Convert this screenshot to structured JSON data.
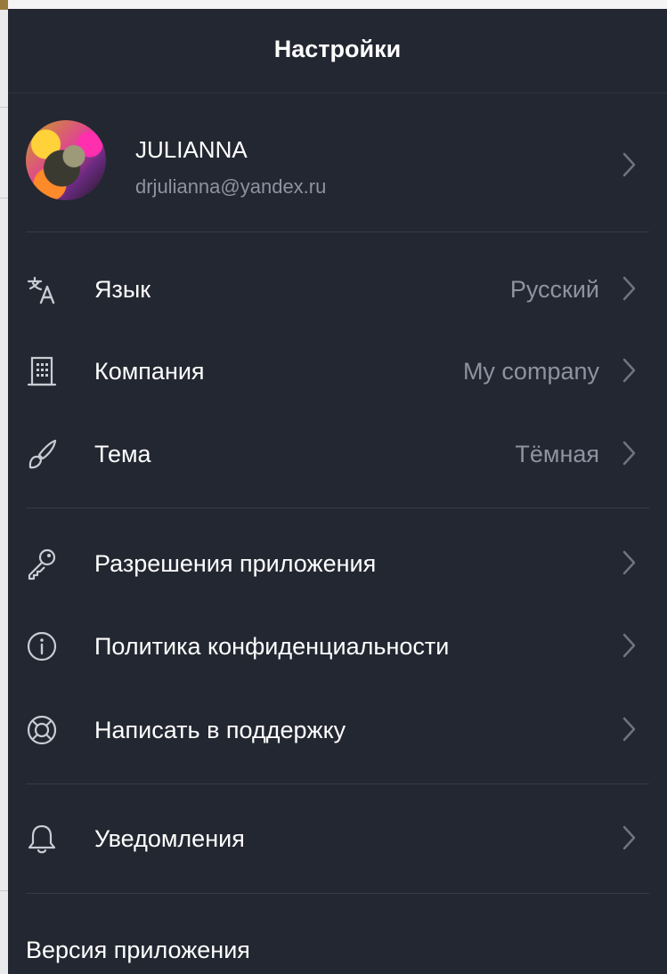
{
  "header": {
    "title": "Настройки"
  },
  "profile": {
    "name": "JULIANNA",
    "email": "drjulianna@yandex.ru"
  },
  "settings": [
    {
      "label": "Язык",
      "value": "Русский",
      "icon": "translate-icon"
    },
    {
      "label": "Компания",
      "value": "My company",
      "icon": "building-icon"
    },
    {
      "label": "Тема",
      "value": "Тёмная",
      "icon": "brush-icon"
    }
  ],
  "info": [
    {
      "label": "Разрешения приложения",
      "icon": "key-icon"
    },
    {
      "label": "Политика конфиденциальности",
      "icon": "info-icon"
    },
    {
      "label": "Написать в поддержку",
      "icon": "lifebuoy-icon"
    }
  ],
  "notifications": {
    "label": "Уведомления",
    "icon": "bell-icon"
  },
  "footer": {
    "app_version_label": "Версия приложения"
  },
  "colors": {
    "background": "#232731",
    "text": "#ffffff",
    "secondary_text": "#8d93a0",
    "divider": "#353a46"
  }
}
